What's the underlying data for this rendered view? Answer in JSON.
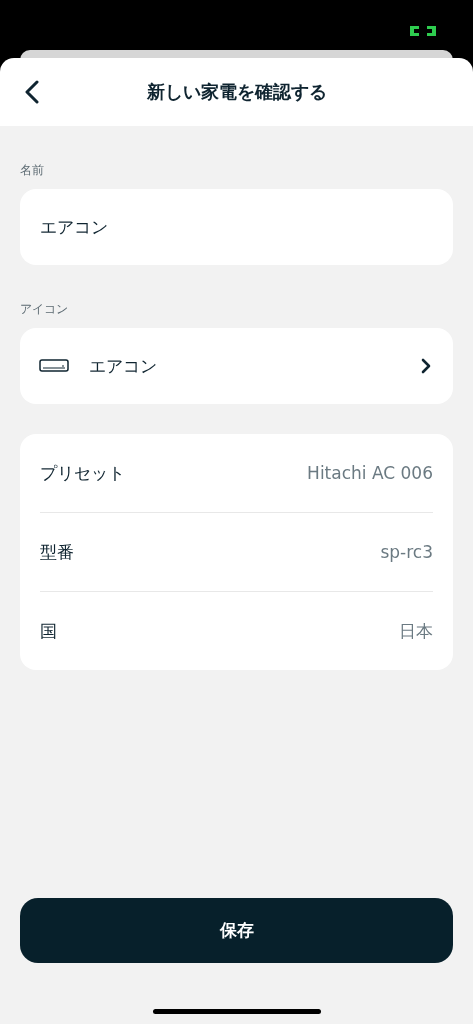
{
  "header": {
    "title": "新しい家電を確認する"
  },
  "name_field": {
    "label": "名前",
    "value": "エアコン"
  },
  "icon_field": {
    "label": "アイコン",
    "value": "エアコン"
  },
  "details": [
    {
      "label": "プリセット",
      "value": "Hitachi AC 006"
    },
    {
      "label": "型番",
      "value": "sp-rc3"
    },
    {
      "label": "国",
      "value": "日本"
    }
  ],
  "save_button": {
    "label": "保存"
  }
}
